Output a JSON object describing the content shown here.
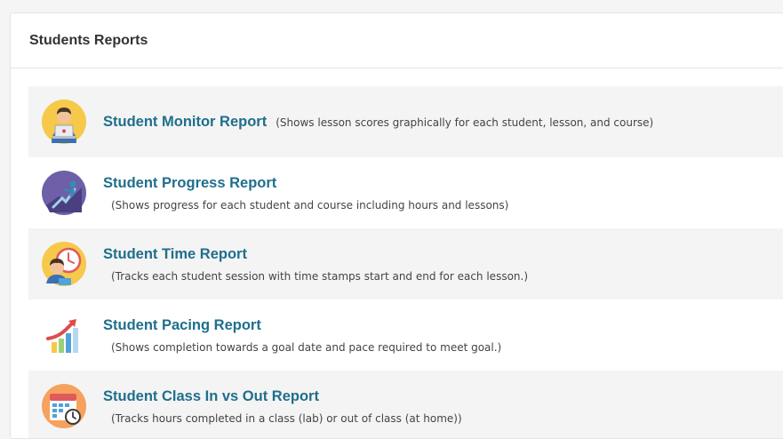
{
  "panel": {
    "title": "Students Reports"
  },
  "reports": [
    {
      "name": "Student Monitor Report",
      "description": "(Shows lesson scores graphically for each student, lesson, and course)",
      "icon": "monitor-icon"
    },
    {
      "name": "Student Progress Report",
      "description": "(Shows progress for each student and course including hours and lessons)",
      "icon": "progress-icon"
    },
    {
      "name": "Student Time Report",
      "description": "(Tracks each student session with time stamps start and end for each lesson.)",
      "icon": "clock-icon"
    },
    {
      "name": "Student Pacing Report",
      "description": "(Shows completion towards a goal date and pace required to meet goal.)",
      "icon": "chart-icon"
    },
    {
      "name": "Student Class In vs Out Report",
      "description": "(Tracks hours completed in a class (lab) or out of class (at home))",
      "icon": "calendar-icon"
    }
  ],
  "colors": {
    "link": "#1f6e8c",
    "row_shade": "#f4f4f4"
  }
}
